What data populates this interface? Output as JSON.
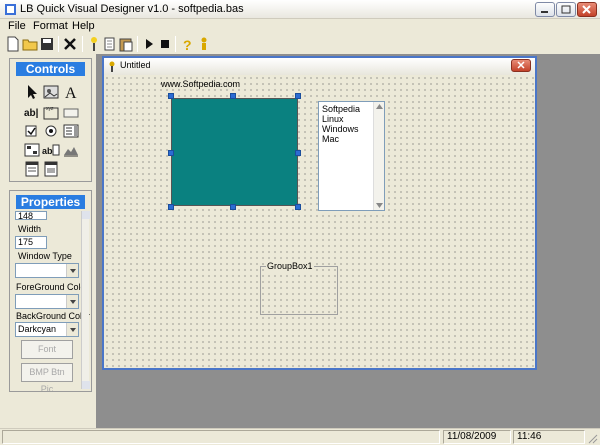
{
  "window": {
    "title": "LB Quick Visual Designer v1.0 - softpedia.bas"
  },
  "menu": [
    "File",
    "Format",
    "Help"
  ],
  "toolbar": {
    "icons": [
      "new-file-icon",
      "open-folder-icon",
      "save-icon",
      "delete-icon",
      "wizard-icon",
      "copy-icon",
      "paste-icon",
      "run-icon",
      "stop-icon",
      "help-icon",
      "about-icon"
    ]
  },
  "controls": {
    "title": "Controls",
    "tools": [
      "pointer-tool",
      "image-tool",
      "label-tool",
      "textbox-tool",
      "frame-tool",
      "button-tool",
      "checkbox-tool",
      "radio-tool",
      "combobox-tool",
      "graphicbox-tool",
      "listbox-tool",
      "bmp-button-tool",
      "statictext-tool",
      "window-tool"
    ]
  },
  "properties": {
    "title": "Properties",
    "first_value": "148",
    "width_label": "Width",
    "width_value": "175",
    "window_type_label": "Window Type",
    "window_type_value": "",
    "foreground_label": "ForeGround Color",
    "foreground_value": "",
    "background_label": "BackGround Color",
    "background_value": "Darkcyan",
    "font_button": "Font",
    "bmp_button": "BMP Btn Pic"
  },
  "child_window": {
    "title": "Untitled",
    "label_text": "www.Softpedia.com",
    "listbox_items": [
      "Softpedia",
      "Linux",
      "Windows",
      "Mac"
    ],
    "groupbox_label": "GroupBox1",
    "teal_color": "#0a8180"
  },
  "status": {
    "empty": "",
    "date": "11/08/2009",
    "time": "11:46"
  }
}
